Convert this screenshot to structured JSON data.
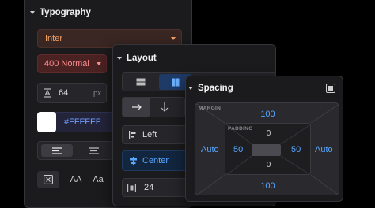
{
  "typography": {
    "title": "Typography",
    "font_family": "Inter",
    "font_weight": "400 Normal",
    "line_height_value": "64",
    "line_height_unit": "px",
    "color_hex": "#FFFFFF",
    "colors": {
      "family_bg": "#3a2622",
      "family_text": "#f2a167",
      "weight_bg": "#4a2222",
      "weight_text": "#ff8d8d",
      "swatch": "#ffffff"
    }
  },
  "layout": {
    "title": "Layout",
    "align_label": "Left",
    "justify_label": "Center",
    "gap_value": "24"
  },
  "spacing": {
    "title": "Spacing",
    "margin_label": "MARGIN",
    "margin_top": "100",
    "margin_bottom": "100",
    "margin_left": "Auto",
    "margin_right": "Auto",
    "padding_label": "PADDING",
    "padding_top": "0",
    "padding_bottom": "0",
    "padding_left": "50",
    "padding_right": "50"
  },
  "icons": [
    "chevron-down-icon",
    "line-height-icon",
    "align-left-icon",
    "align-center-icon",
    "clear-format-icon",
    "uppercase-icon",
    "sentence-case-icon",
    "rows-icon",
    "columns-icon",
    "arrow-right-icon",
    "arrow-down-icon",
    "align-left-edge-icon",
    "justify-center-icon",
    "gap-icon",
    "expand-icon"
  ],
  "accent": "#3b82f6"
}
